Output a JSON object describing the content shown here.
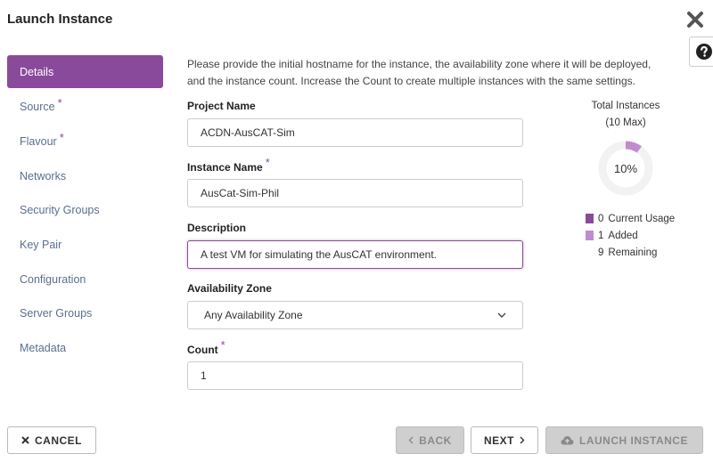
{
  "dialog": {
    "title": "Launch Instance"
  },
  "sidebar": {
    "items": [
      {
        "label": "Details",
        "required": false,
        "active": true
      },
      {
        "label": "Source",
        "required": true,
        "active": false
      },
      {
        "label": "Flavour",
        "required": true,
        "active": false
      },
      {
        "label": "Networks",
        "required": false,
        "active": false
      },
      {
        "label": "Security Groups",
        "required": false,
        "active": false
      },
      {
        "label": "Key Pair",
        "required": false,
        "active": false
      },
      {
        "label": "Configuration",
        "required": false,
        "active": false
      },
      {
        "label": "Server Groups",
        "required": false,
        "active": false
      },
      {
        "label": "Metadata",
        "required": false,
        "active": false
      }
    ]
  },
  "intro_line1": "Please provide the initial hostname for the instance, the availability zone where it will be deployed,",
  "intro_line2": "and the instance count. Increase the Count to create multiple instances with the same settings.",
  "form": {
    "project_name": {
      "label": "Project Name",
      "value": "ACDN-AusCAT-Sim"
    },
    "instance_name": {
      "label": "Instance Name",
      "value": "AusCat-Sim-Phil",
      "required_mark": "*"
    },
    "description": {
      "label": "Description",
      "value": "A test VM for simulating the AusCAT environment."
    },
    "availability_zone": {
      "label": "Availability Zone",
      "selected": "Any Availability Zone"
    },
    "count": {
      "label": "Count",
      "value": "1",
      "required_mark": "*"
    }
  },
  "required_mark": "*",
  "quota": {
    "title_line1": "Total Instances",
    "title_line2": "(10 Max)",
    "percent_label": "10%",
    "max": 10,
    "current_usage": 0,
    "added": 1,
    "remaining": 9,
    "legend": {
      "current_label": "Current Usage",
      "current_value": "0",
      "added_label": "Added",
      "added_value": "1",
      "remaining_label": "Remaining",
      "remaining_value": "9"
    },
    "colors": {
      "current": "#8a4a9c",
      "added": "#c08bd0",
      "track": "#f2f2f2"
    }
  },
  "footer": {
    "cancel_label": "CANCEL",
    "back_label": "BACK",
    "next_label": "NEXT",
    "launch_label": "LAUNCH INSTANCE"
  },
  "icons": {
    "close": "close-icon",
    "help": "question-circle-icon",
    "cancel": "times-icon",
    "back": "chevron-left-icon",
    "next": "chevron-right-icon",
    "launch": "cloud-upload-icon",
    "select": "chevron-down-icon"
  },
  "colors": {
    "accent": "#8a4a9c",
    "nav_text": "#5a6f8e"
  }
}
